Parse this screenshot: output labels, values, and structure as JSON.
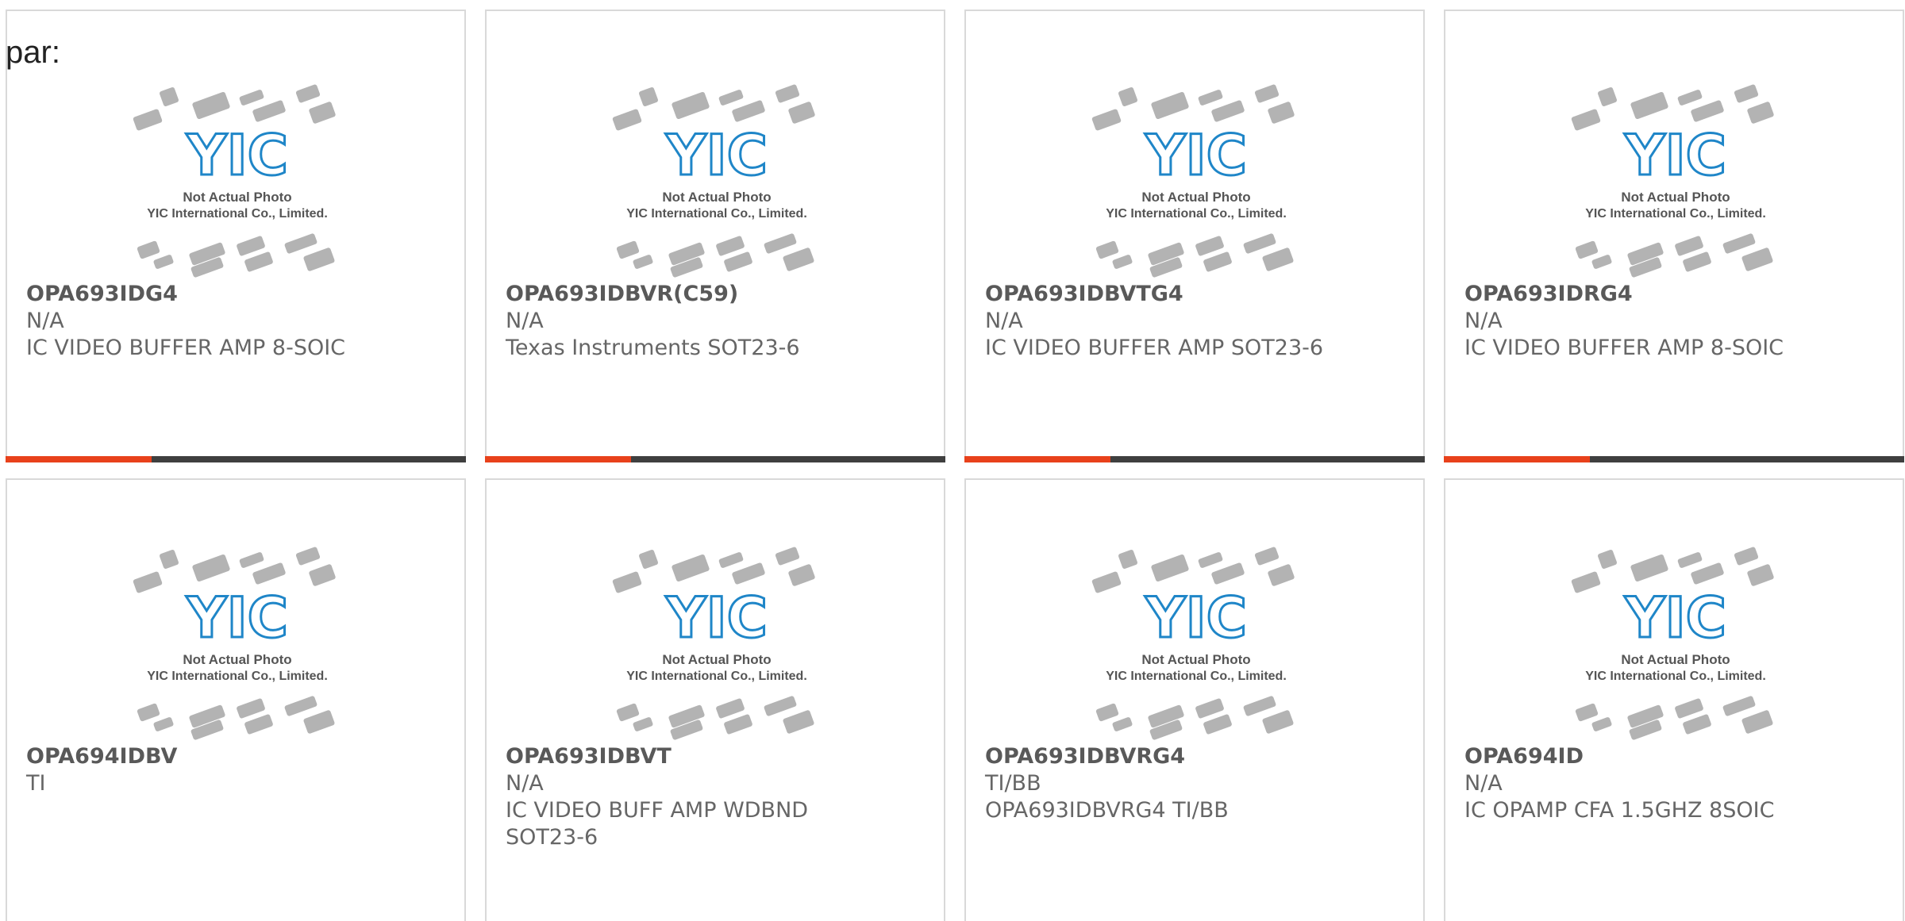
{
  "label": "par:",
  "photo": {
    "logo_text": "YIC",
    "line1": "Not Actual Photo",
    "line2": "YIC International Co., Limited."
  },
  "colors": {
    "accent": "#e8411b",
    "bar": "#3f3f3f",
    "logo": "#1f86c8",
    "chip": "#a6a6a6",
    "text": "#666666"
  },
  "products": [
    {
      "pn": "OPA693IDG4",
      "mfr": "N/A",
      "desc": "IC VIDEO BUFFER AMP 8-SOIC",
      "desc2": ""
    },
    {
      "pn": "OPA693IDBVR(C59)",
      "mfr": "N/A",
      "desc": "Texas Instruments SOT23-6",
      "desc2": ""
    },
    {
      "pn": "OPA693IDBVTG4",
      "mfr": "N/A",
      "desc": "IC VIDEO BUFFER AMP SOT23-6",
      "desc2": ""
    },
    {
      "pn": "OPA693IDRG4",
      "mfr": "N/A",
      "desc": "IC VIDEO BUFFER AMP 8-SOIC",
      "desc2": ""
    },
    {
      "pn": "OPA694IDBV",
      "mfr": "TI",
      "desc": "",
      "desc2": ""
    },
    {
      "pn": "OPA693IDBVT",
      "mfr": "N/A",
      "desc": "IC VIDEO BUFF AMP WDBND",
      "desc2": "SOT23-6"
    },
    {
      "pn": "OPA693IDBVRG4",
      "mfr": "TI/BB",
      "desc": "OPA693IDBVRG4 TI/BB",
      "desc2": ""
    },
    {
      "pn": "OPA694ID",
      "mfr": "N/A",
      "desc": "IC OPAMP CFA 1.5GHZ 8SOIC",
      "desc2": ""
    }
  ]
}
